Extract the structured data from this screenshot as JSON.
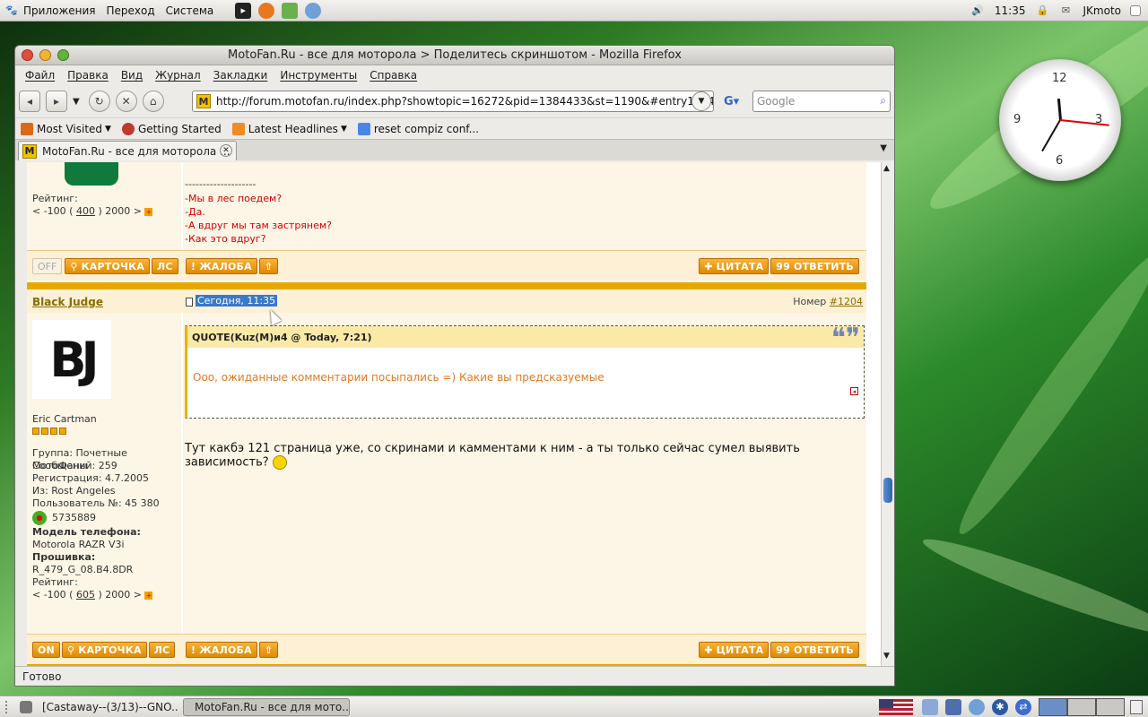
{
  "top_panel": {
    "menus": [
      "Приложения",
      "Переход",
      "Система"
    ],
    "clock": "11:35",
    "user": "JKmoto"
  },
  "window": {
    "title": "MotoFan.Ru - все для моторола > Поделитесь скриншотом - Mozilla Firefox",
    "menu": [
      "Файл",
      "Правка",
      "Вид",
      "Журнал",
      "Закладки",
      "Инструменты",
      "Справка"
    ],
    "url": "http://forum.motofan.ru/index.php?showtopic=16272&pid=1384433&st=1190&#entry1384",
    "search_placeholder": "Google",
    "bookmarks": [
      "Most Visited",
      "Getting Started",
      "Latest Headlines",
      "reset compiz conf..."
    ],
    "tab_title": "MotoFan.Ru - все для моторола ...",
    "status": "Готово"
  },
  "post1": {
    "rating_label": "Рейтинг:",
    "rating": {
      "left": "< -100 (",
      "value": "400",
      "right": ") 2000 >"
    },
    "divider": "--------------------",
    "lines": [
      "-Мы в лес поедем?",
      "-Да.",
      "-А вдруг мы там застрянем?",
      "-Как это вдруг?"
    ],
    "buttons_left": [
      "OFF",
      "КАРТОЧКА",
      "ЛС"
    ],
    "buttons_right": [
      "ЖАЛОБА",
      "ЦИТАТА",
      "ОТВЕТИТЬ"
    ]
  },
  "post2": {
    "author": "Black Judge",
    "avatar_text": "BJ",
    "title": "Eric Cartman",
    "date": "Сегодня, 11:35",
    "number_label": "Номер",
    "number": "#1204",
    "quote_header": "QUOTE(Kuz(M)и4 @ Today, 7:21)",
    "quote_text": "Ооо, ожиданные комментарии посыпались =) Какие вы предсказуемые",
    "body": "Тут какбэ 121 страница уже, со скринами и камментами к ним - а ты только сейчас сумел выявить зависимость?",
    "group": "Группа: Почетные МотоФаны",
    "messages": "Сообщений: 259",
    "registration": "Регистрация: 4.7.2005",
    "from": "Из: Rost Angeles",
    "user_no": "Пользователь №: 45 380",
    "icq": "5735889",
    "phone_label": "Модель телефона:",
    "phone_value": "Motorola RAZR V3i",
    "firmware_label": "Прошивка:",
    "firmware_value": "R_479_G_08.B4.8DR",
    "rating_label": "Рейтинг:",
    "rating": {
      "left": "< -100 (",
      "value": "605",
      "right": ") 2000 >"
    },
    "buttons_left": [
      "ON",
      "КАРТОЧКА",
      "ЛС"
    ],
    "buttons_right": [
      "ЖАЛОБА",
      "ЦИТАТА",
      "ОТВЕТИТЬ"
    ]
  },
  "taskbar": [
    "[Castaway--(3/13)--GNO...",
    "MotoFan.Ru - все для мото..."
  ],
  "clock_widget": {
    "numbers": [
      "12",
      "3",
      "6",
      "9"
    ]
  }
}
